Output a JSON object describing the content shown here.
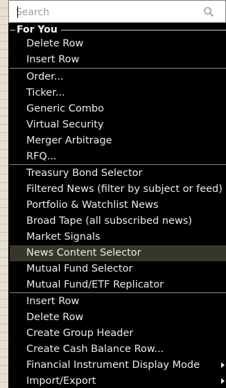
{
  "search": {
    "placeholder": "Search",
    "icon": "search-icon"
  },
  "section": {
    "title": "For You"
  },
  "items": [
    {
      "label": "Delete Row"
    },
    {
      "label": "Insert Row"
    },
    {
      "label": "Order..."
    },
    {
      "label": "Ticker..."
    },
    {
      "label": "Generic Combo"
    },
    {
      "label": "Virtual Security"
    },
    {
      "label": "Merger Arbitrage"
    },
    {
      "label": "RFQ..."
    },
    {
      "label": "Treasury Bond Selector"
    },
    {
      "label": "Filtered News (filter by subject or feed)"
    },
    {
      "label": "Portfolio & Watchlist News"
    },
    {
      "label": "Broad Tape (all subscribed news)"
    },
    {
      "label": "Market Signals"
    },
    {
      "label": "News Content Selector",
      "highlighted": true
    },
    {
      "label": "Mutual Fund Selector"
    },
    {
      "label": "Mutual Fund/ETF Replicator"
    },
    {
      "label": "Insert Row"
    },
    {
      "label": "Delete Row"
    },
    {
      "label": "Create Group Header"
    },
    {
      "label": "Create Cash Balance Row..."
    },
    {
      "label": "Financial Instrument Display Mode",
      "submenu": true
    },
    {
      "label": "Import/Export",
      "submenu": true
    }
  ],
  "colors": {
    "menu_bg": "#000000",
    "highlight": "#36362b",
    "text": "#ececec"
  }
}
